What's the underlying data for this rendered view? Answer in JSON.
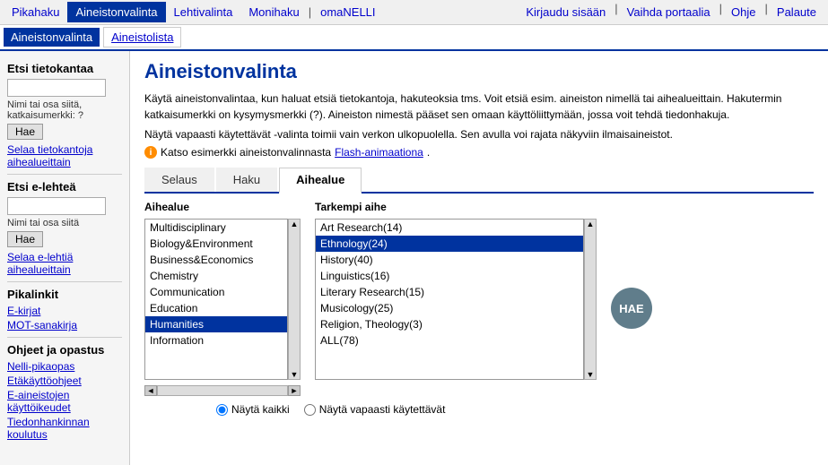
{
  "topnav": {
    "tabs": [
      {
        "label": "Pikahaku",
        "active": false
      },
      {
        "label": "Aineistonvalinta",
        "active": true
      },
      {
        "label": "Lehtivalinta",
        "active": false
      },
      {
        "label": "Monihaku",
        "active": false
      },
      {
        "label": "omaNELLI",
        "active": false
      }
    ],
    "right_links": [
      {
        "label": "Kirjaudu sisään"
      },
      {
        "label": "Vaihda portaalia"
      },
      {
        "label": "Ohje"
      },
      {
        "label": "Palaute"
      }
    ]
  },
  "subnav": {
    "tabs": [
      {
        "label": "Aineistonvalinta",
        "active": true
      },
      {
        "label": "Aineistolista",
        "active": false
      }
    ]
  },
  "sidebar": {
    "db_section_title": "Etsi tietokantaa",
    "db_input_placeholder": "",
    "db_desc": "Nimi tai osa siitä, katkaisumerkki: ?",
    "db_button": "Hae",
    "db_link": "Selaa tietokantoja aihealueittain",
    "journal_section_title": "Etsi e-lehteä",
    "journal_desc": "Nimi tai osa siitä",
    "journal_button": "Hae",
    "journal_link": "Selaa e-lehtiä aihealueittain",
    "links_title": "Pikalinkit",
    "links": [
      {
        "label": "E-kirjat"
      },
      {
        "label": "MOT-sanakirja"
      }
    ],
    "help_title": "Ohjeet ja opastus",
    "help_links": [
      {
        "label": "Nelli-pikaopas"
      },
      {
        "label": "Etäkäyttöohjeet"
      },
      {
        "label": "E-aineistojen käyttöikeudet"
      },
      {
        "label": "Tiedonhankinnan koulutus"
      }
    ]
  },
  "main": {
    "title": "Aineistonvalinta",
    "intro1": "Käytä aineistonvalintaa, kun haluat etsiä tietokantoja, hakuteoksia tms. Voit etsiä esim. aineiston nimellä tai aihealueittain. Hakutermin katkaisumerkki on kysymysmerkki (?). Aineiston nimestä pääset sen omaan käyttöliittymään, jossa voit tehdä tiedonhakuja.",
    "intro2": "Näytä vapaasti käytettävät -valinta toimii vain verkon ulkopuolella. Sen avulla voi rajata näkyviin ilmaisaineistot.",
    "flash_text": "Katso esimerkki aineistonvalinnasta",
    "flash_link_label": "Flash-animaationa",
    "tabs": [
      {
        "label": "Selaus",
        "active": false
      },
      {
        "label": "Haku",
        "active": false
      },
      {
        "label": "Aihealue",
        "active": true
      }
    ],
    "aihealue_label": "Aihealue",
    "tarkempi_label": "Tarkempi aihe",
    "categories": [
      {
        "label": "Multidisciplinary",
        "selected": false
      },
      {
        "label": "Biology&Environment",
        "selected": false
      },
      {
        "label": "Business&Economics",
        "selected": false
      },
      {
        "label": "Chemistry",
        "selected": false
      },
      {
        "label": "Communication",
        "selected": false
      },
      {
        "label": "Education",
        "selected": false
      },
      {
        "label": "Humanities",
        "selected": true
      },
      {
        "label": "Information",
        "selected": false
      }
    ],
    "subcategories": [
      {
        "label": "Art Research(14)",
        "selected": false
      },
      {
        "label": "Ethnology(24)",
        "selected": true
      },
      {
        "label": "History(40)",
        "selected": false
      },
      {
        "label": "Linguistics(16)",
        "selected": false
      },
      {
        "label": "Literary Research(15)",
        "selected": false
      },
      {
        "label": "Musicology(25)",
        "selected": false
      },
      {
        "label": "Religion, Theology(3)",
        "selected": false
      },
      {
        "label": "ALL(78)",
        "selected": false
      }
    ],
    "hae_label": "HAE",
    "radio_options": [
      {
        "label": "Näytä kaikki",
        "selected": true
      },
      {
        "label": "Näytä vapaasti käytettävät",
        "selected": false
      }
    ]
  }
}
